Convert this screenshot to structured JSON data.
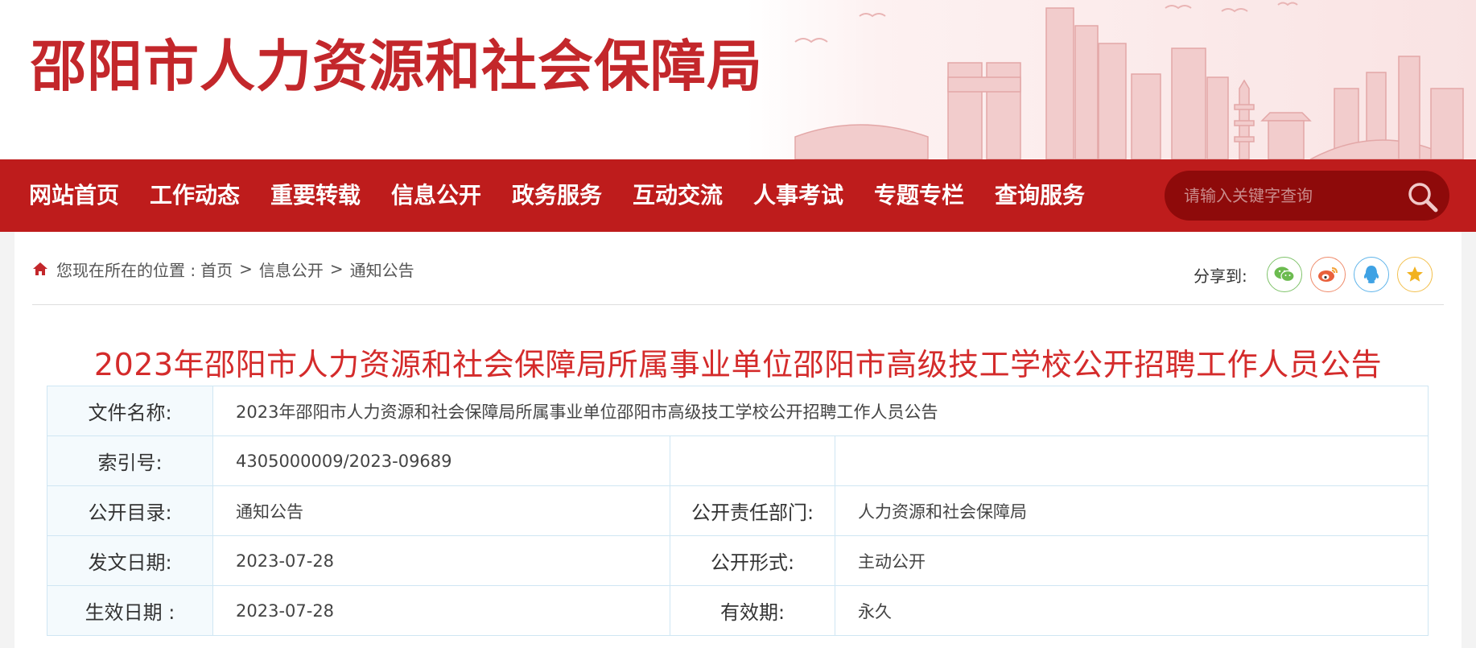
{
  "site": {
    "title": "邵阳市人力资源和社会保障局"
  },
  "nav": {
    "items": [
      "网站首页",
      "工作动态",
      "重要转载",
      "信息公开",
      "政务服务",
      "互动交流",
      "人事考试",
      "专题专栏",
      "查询服务"
    ],
    "search_placeholder": "请输入关键字查询"
  },
  "breadcrumb": {
    "prefix": "您现在所在的位置 :",
    "items": [
      "首页",
      "信息公开",
      "通知公告"
    ],
    "separator": ">"
  },
  "share": {
    "label": "分享到:",
    "icons": [
      "wechat-icon",
      "weibo-icon",
      "qq-icon",
      "favorite-star-icon"
    ]
  },
  "article": {
    "title": "2023年邵阳市人力资源和社会保障局所属事业单位邵阳市高级技工学校公开招聘工作人员公告"
  },
  "info": {
    "file_name_label": "文件名称:",
    "file_name": "2023年邵阳市人力资源和社会保障局所属事业单位邵阳市高级技工学校公开招聘工作人员公告",
    "index_label": "索引号:",
    "index": "4305000009/2023-09689",
    "catalog_label": "公开目录:",
    "catalog": "通知公告",
    "dept_label": "公开责任部门:",
    "dept": "人力资源和社会保障局",
    "issue_date_label": "发文日期:",
    "issue_date": "2023-07-28",
    "form_label": "公开形式:",
    "form": "主动公开",
    "effective_date_label": "生效日期 :",
    "effective_date": "2023-07-28",
    "validity_label": "有效期:",
    "validity": "永久"
  },
  "colors": {
    "brand_red": "#be1c1c",
    "title_red": "#c3272b",
    "search_bg": "#8e0a0a",
    "table_border": "#cfe6f3"
  }
}
